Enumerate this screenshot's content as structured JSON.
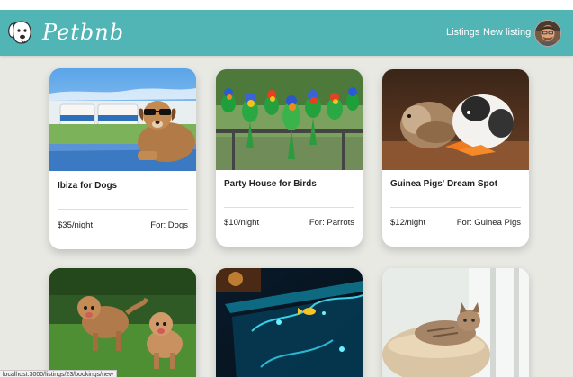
{
  "navbar": {
    "brand": "Petbnb",
    "links": [
      {
        "label": "Listings"
      },
      {
        "label": "New listing"
      }
    ],
    "accent_color": "#51b4b5"
  },
  "listings": [
    {
      "title": "Ibiza for Dogs",
      "price": "$35/night",
      "for": "For: Dogs",
      "image": "dog-sunglasses-on-boat"
    },
    {
      "title": "Party House for Birds",
      "price": "$10/night",
      "for": "For: Parrots",
      "image": "parrots-on-rail"
    },
    {
      "title": "Guinea Pigs' Dream Spot",
      "price": "$12/night",
      "for": "For: Guinea Pigs",
      "image": "guinea-pigs-with-carrots"
    },
    {
      "image": "two-dogs-running-on-grass"
    },
    {
      "image": "fish-aquarium"
    },
    {
      "image": "cat-in-basket"
    }
  ],
  "status_url": "localhost:3000/listings/23/bookings/new"
}
